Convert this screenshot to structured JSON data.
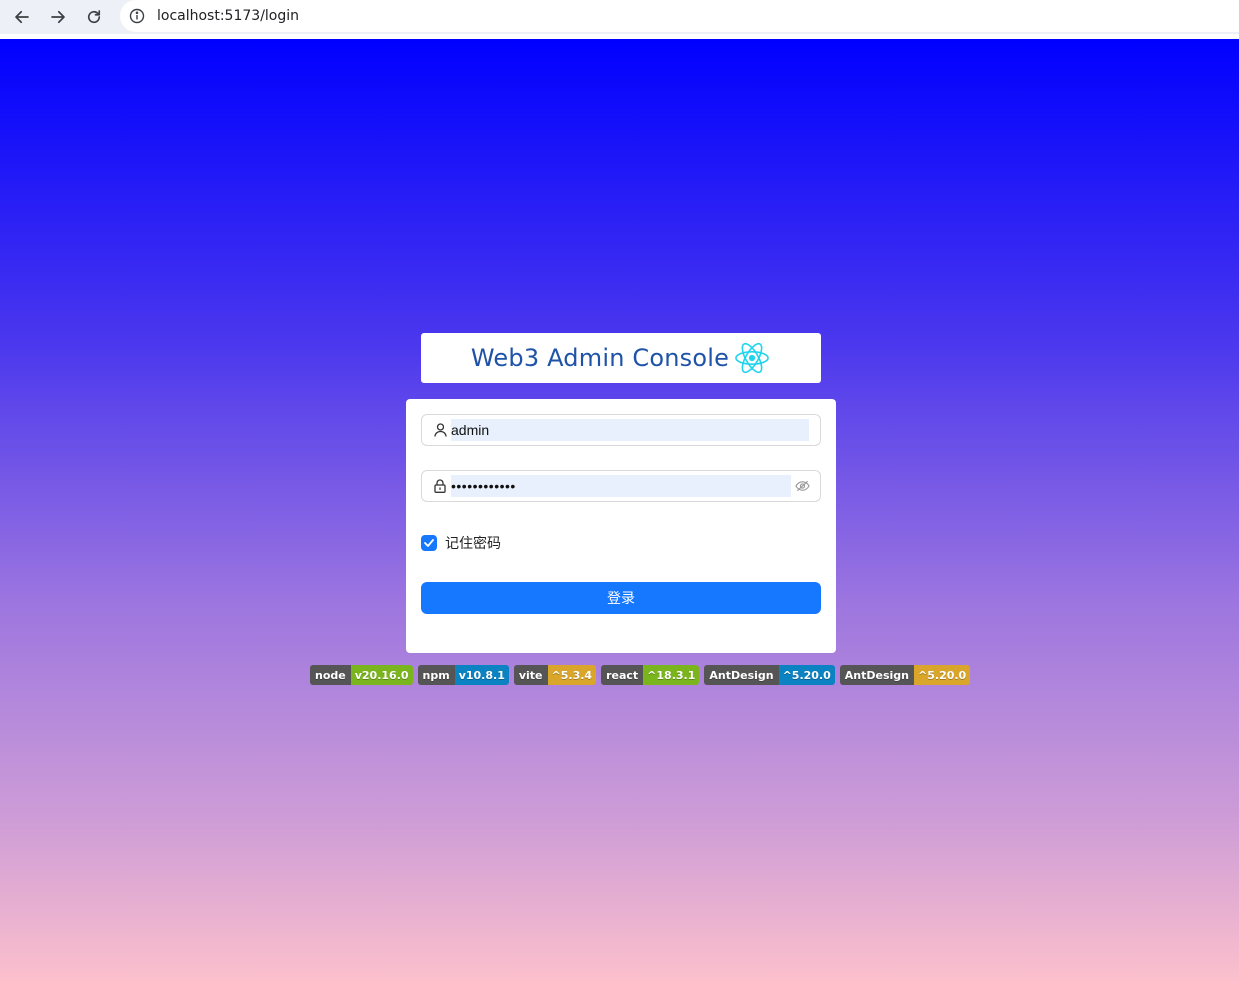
{
  "browser": {
    "url": "localhost:5173/login"
  },
  "header": {
    "title": "Web3 Admin Console",
    "logo_icon": "react-atom-icon"
  },
  "form": {
    "username_value": "admin",
    "password_value": "••••••••••••",
    "remember_label": "记住密码",
    "remember_checked": true,
    "submit_label": "登录"
  },
  "badges": [
    {
      "label": "node",
      "value": "v20.16.0",
      "color": "#7ab51d"
    },
    {
      "label": "npm",
      "value": "v10.8.1",
      "color": "#0b82c2"
    },
    {
      "label": "vite",
      "value": "^5.3.4",
      "color": "#d9a52a"
    },
    {
      "label": "react",
      "value": "^18.3.1",
      "color": "#7ab51d"
    },
    {
      "label": "AntDesign",
      "value": "^5.20.0",
      "color": "#0b82c2"
    },
    {
      "label": "AntDesign",
      "value": "^5.20.0",
      "color": "#d9a52a"
    }
  ],
  "colors": {
    "primary": "#1677ff",
    "title": "#1f53a8",
    "gradient_top": "#0000ff",
    "gradient_bottom": "#fcc0cc"
  }
}
